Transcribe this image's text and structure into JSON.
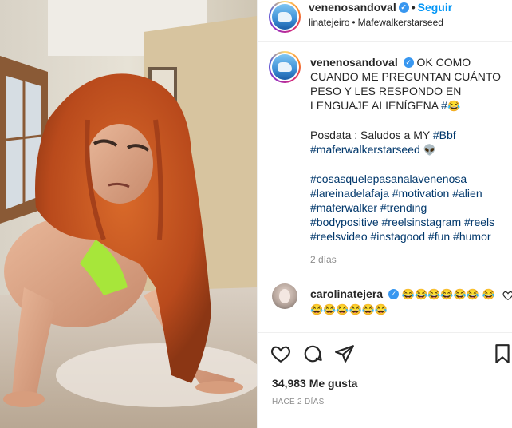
{
  "header": {
    "username": "venenosandoval",
    "verified_glyph": "✓",
    "separator": "•",
    "follow_label": "Seguir",
    "tagged_user": "linatejeiro",
    "sub_separator": "•",
    "audio_label": "Mafewalkerstarseed"
  },
  "caption": {
    "username": "venenosandoval",
    "verified_glyph": "✓",
    "text_1": "OK COMO CUANDO ME PREGUNTAN CUÁNTO PESO Y LES RESPONDO EN LENGUAJE ALIENÍGENA ",
    "hashtag_1": "#",
    "emoji_1": "😂",
    "p2_text": "Posdata : Saludos a MY ",
    "p2_tag_1": "#Bbf",
    "p2_tag_2": "#maferwalkerstarseed",
    "p2_emoji": "👽",
    "tags": [
      "#cosasquelepasanalavenenosa",
      "#lareinadelafaja",
      "#motivation",
      "#alien",
      "#maferwalker",
      "#trending",
      "#bodypositive",
      "#reelsinstagram",
      "#reels",
      "#reelsvideo",
      "#instagood",
      "#fun",
      "#humor"
    ],
    "time": "2 días"
  },
  "comment": {
    "username": "carolinatejera",
    "verified_glyph": "✓",
    "emojis": "😂😂😂😂😂😂 😂😂😂😂😂😂😂"
  },
  "actions": {
    "icons": [
      "heart-icon",
      "comment-icon",
      "share-icon",
      "bookmark-icon"
    ]
  },
  "likes": "34,983 Me gusta",
  "post_time": "HACE 2 DÍAS",
  "colors": {
    "link": "#00376b",
    "follow": "#0095f6",
    "verified": "#3897f0",
    "muted": "#8e8e8e"
  }
}
